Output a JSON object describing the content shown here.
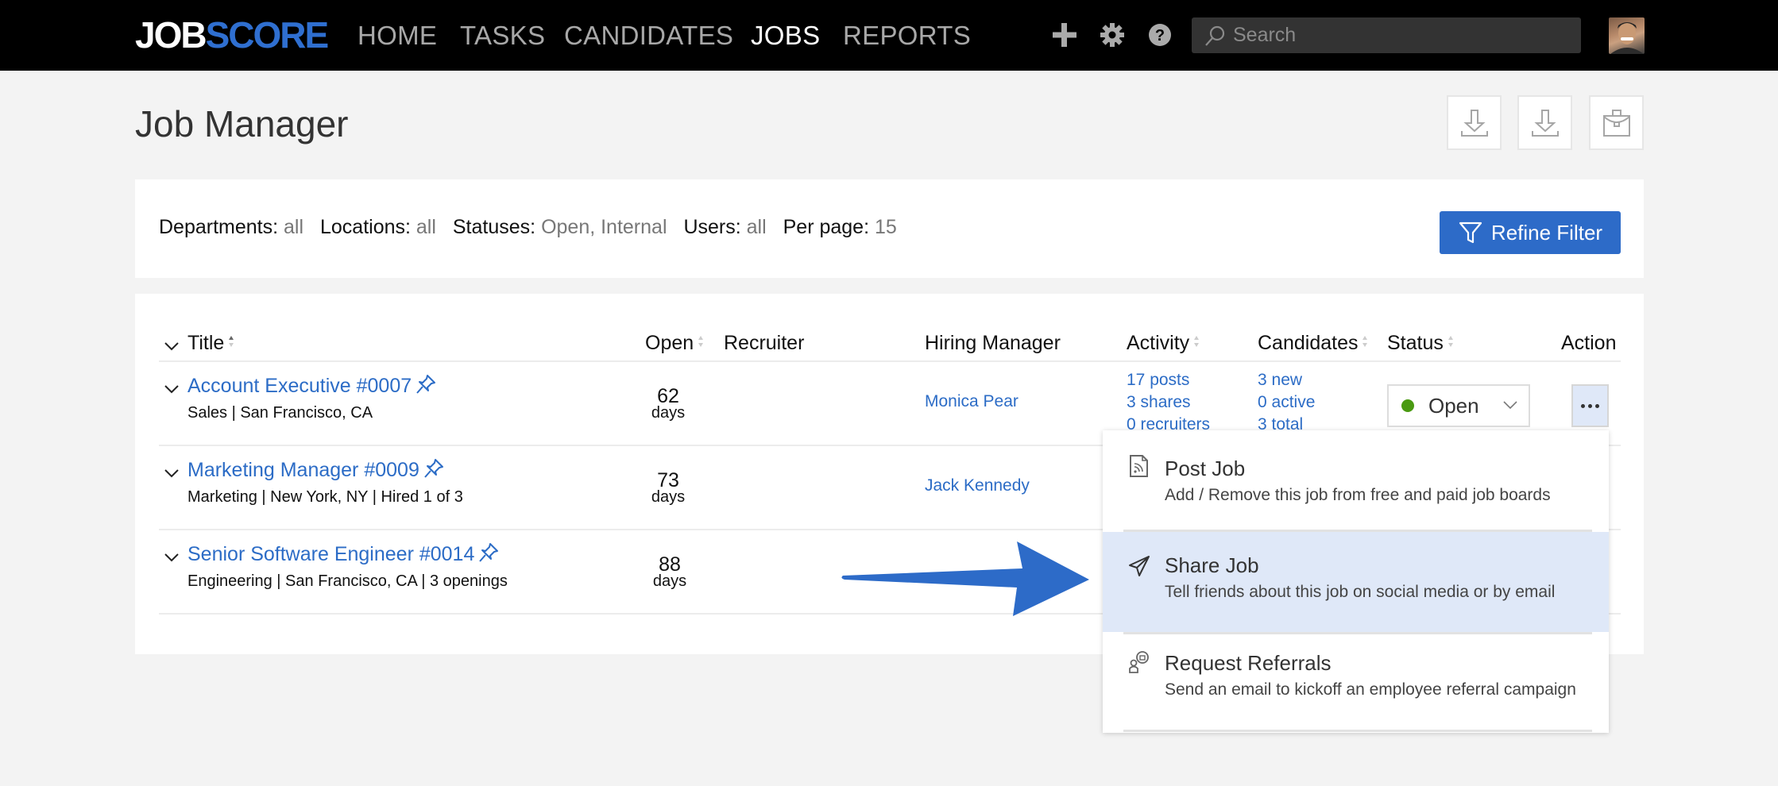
{
  "nav": {
    "logo_part1": "JOB",
    "logo_part2": "SCORE",
    "links": [
      {
        "label": "HOME",
        "active": false
      },
      {
        "label": "TASKS",
        "active": false
      },
      {
        "label": "CANDIDATES",
        "active": false
      },
      {
        "label": "JOBS",
        "active": true
      },
      {
        "label": "REPORTS",
        "active": false
      }
    ],
    "icons": [
      "plus-icon",
      "gear-icon",
      "help-icon"
    ],
    "search_placeholder": "Search"
  },
  "page": {
    "title": "Job Manager",
    "toolbar_icons": [
      "download-icon",
      "download-icon",
      "briefcase-icon"
    ]
  },
  "filters": {
    "items": [
      {
        "key": "Departments:",
        "value": "all"
      },
      {
        "key": "Locations:",
        "value": "all"
      },
      {
        "key": "Statuses:",
        "value": "Open, Internal"
      },
      {
        "key": "Users:",
        "value": "all"
      },
      {
        "key": "Per page:",
        "value": "15"
      }
    ],
    "refine_label": "Refine Filter"
  },
  "table": {
    "headers": {
      "title": "Title",
      "open": "Open",
      "recruiter": "Recruiter",
      "hiring_manager": "Hiring Manager",
      "activity": "Activity",
      "candidates": "Candidates",
      "status": "Status",
      "action": "Action"
    },
    "rows": [
      {
        "title": "Account Executive #0007",
        "subtitle": "Sales | San Francisco, CA",
        "open_days": "62",
        "days_unit": "days",
        "recruiter": "",
        "hiring_manager": "Monica Pear",
        "activity": [
          "17 posts",
          "3 shares",
          "0 recruiters"
        ],
        "candidates": [
          "3 new",
          "0 active",
          "3 total"
        ],
        "status": "Open"
      },
      {
        "title": "Marketing Manager #0009",
        "subtitle": "Marketing | New York, NY | Hired 1 of 3",
        "open_days": "73",
        "days_unit": "days",
        "recruiter": "",
        "hiring_manager": "Jack Kennedy"
      },
      {
        "title": "Senior Software Engineer #0014",
        "subtitle": "Engineering | San Francisco, CA | 3 openings",
        "open_days": "88",
        "days_unit": "days",
        "recruiter": "",
        "hiring_manager": ""
      }
    ]
  },
  "action_menu": {
    "items": [
      {
        "icon": "rss-document-icon",
        "label": "Post Job",
        "description": "Add / Remove this job from free and paid job boards",
        "highlighted": false
      },
      {
        "icon": "paper-plane-icon",
        "label": "Share Job",
        "description": "Tell friends about this job on social media or by email",
        "highlighted": true
      },
      {
        "icon": "referral-icon",
        "label": "Request Referrals",
        "description": "Send an email to kickoff an employee referral campaign",
        "highlighted": false
      }
    ]
  },
  "colors": {
    "brand_blue": "#2f6fd0",
    "link_blue": "#2c6cc6",
    "button_blue": "#2d6bc8",
    "highlight": "#dfe8f8",
    "status_open": "#4a9a12",
    "nav_bg": "#000000",
    "page_bg": "#f3f3f3"
  }
}
